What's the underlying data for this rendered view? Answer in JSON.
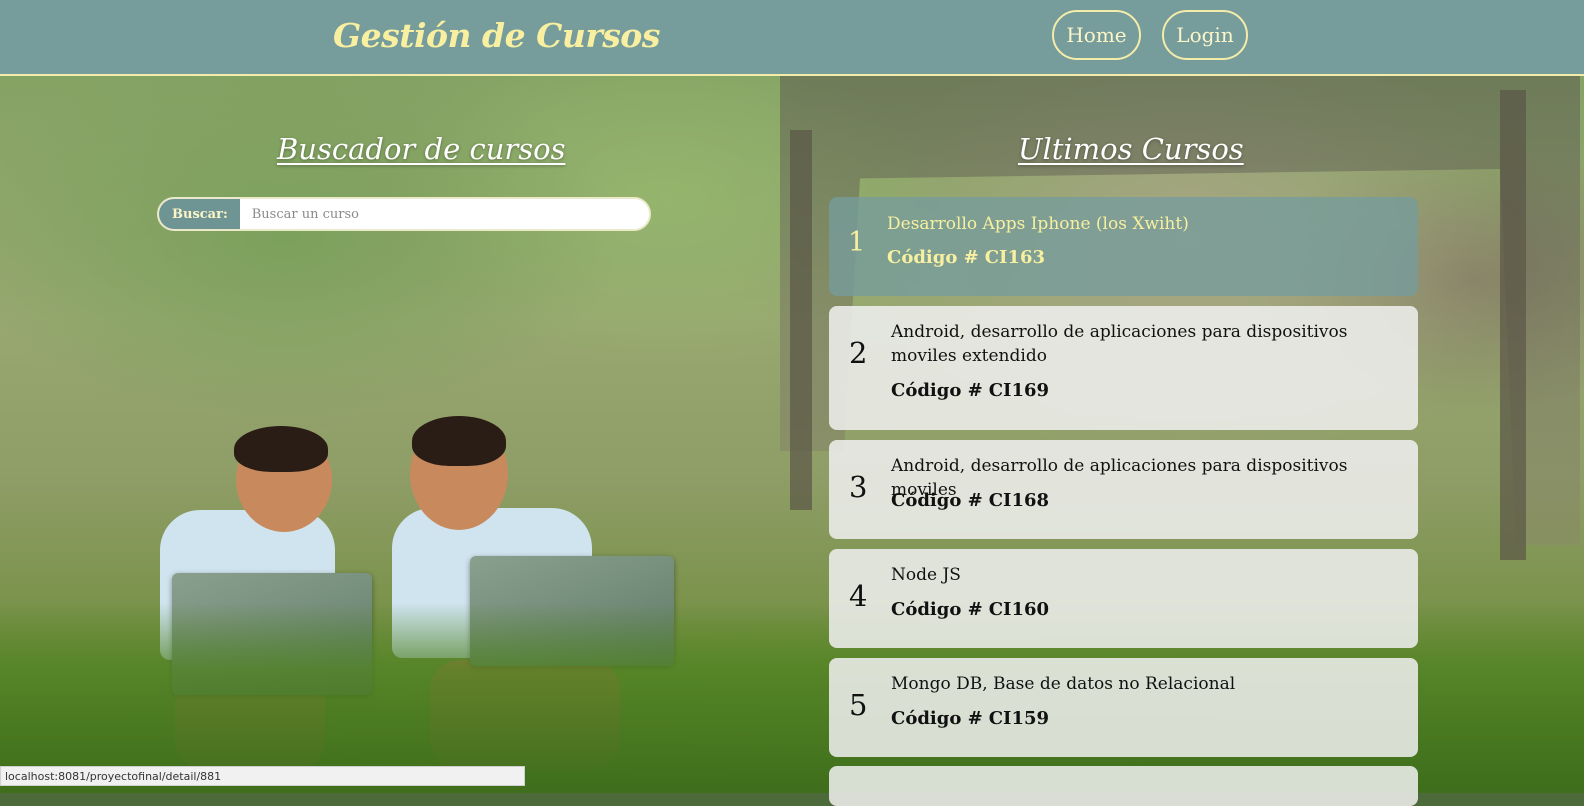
{
  "header": {
    "brand": "Gestión de Cursos",
    "nav": {
      "home": "Home",
      "login": "Login"
    }
  },
  "search": {
    "title": "Buscador de cursos",
    "label": "Buscar:",
    "placeholder": "Buscar un curso",
    "value": ""
  },
  "latest": {
    "title": "Ultimos Cursos",
    "code_label": "Código #",
    "courses": [
      {
        "num": "1",
        "name": "Desarrollo Apps Iphone (los Xwiht)",
        "code": "CI163"
      },
      {
        "num": "2",
        "name": "Android, desarrollo de aplicaciones para dispositivos moviles extendido",
        "code": "CI169"
      },
      {
        "num": "3",
        "name": "Android, desarrollo de aplicaciones para dispositivos moviles",
        "code": "CI168"
      },
      {
        "num": "4",
        "name": "Node JS",
        "code": "CI160"
      },
      {
        "num": "5",
        "name": "Mongo DB, Base de datos no Relacional",
        "code": "CI159"
      }
    ]
  },
  "status_bar": {
    "url": "localhost:8081/proyectofinal/detail/881"
  },
  "colors": {
    "header_bg": "#769c9c",
    "accent": "#f8f0a0",
    "active_card": "#769c9c",
    "card": "#f0f0f0"
  }
}
